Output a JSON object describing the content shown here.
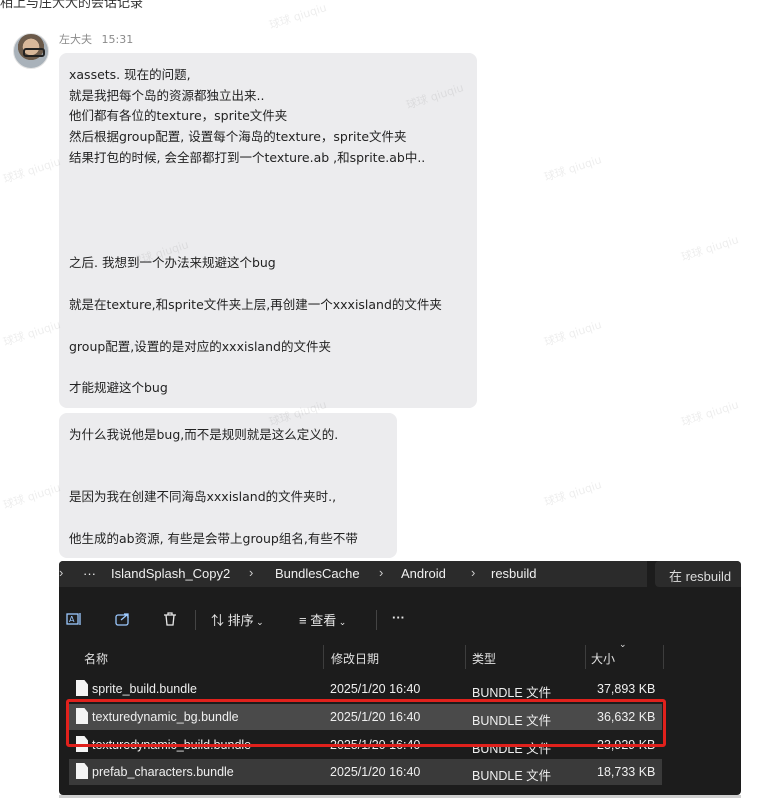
{
  "top_cut_text": "相上与庄大大的会话记录",
  "message": {
    "sender": "左大夫",
    "time": "15:31",
    "bubble1_lines": [
      "xassets. 现在的问题,",
      "就是我把每个岛的资源都独立出来..",
      "他们都有各位的texture，sprite文件夹",
      "然后根据group配置, 设置每个海岛的texture，sprite文件夹",
      "结果打包的时候, 会全部都打到一个texture.ab ,和sprite.ab中..",
      "之后. 我想到一个办法来规避这个bug",
      "就是在texture,和sprite文件夹上层,再创建一个xxxisland的文件夹",
      "group配置,设置的是对应的xxxisland的文件夹",
      "才能规避这个bug"
    ],
    "bubble2_lines": [
      "为什么我说他是bug,而不是规则就是这么定义的.",
      "是因为我在创建不同海岛xxxisland的文件夹时.,",
      "他生成的ab资源, 有些是会带上group组名,有些不带"
    ]
  },
  "watermark_text": "球球 qiuqiu",
  "explorer": {
    "breadcrumb": [
      "IslandSplash_Copy2",
      "BundlesCache",
      "Android",
      "resbuild"
    ],
    "more_crumbs": "···",
    "search_placeholder": "在 resbuild",
    "toolbar": {
      "sort_label": "排序",
      "view_label": "查看",
      "more_label": "···"
    },
    "columns": [
      "名称",
      "修改日期",
      "类型",
      "大小"
    ],
    "files": [
      {
        "name": "sprite_build.bundle",
        "date": "2025/1/20 16:40",
        "type": "BUNDLE 文件",
        "size": "37,893 KB"
      },
      {
        "name": "texturedynamic_bg.bundle",
        "date": "2025/1/20 16:40",
        "type": "BUNDLE 文件",
        "size": "36,632 KB"
      },
      {
        "name": "texturedynamic_build.bundle",
        "date": "2025/1/20 16:40",
        "type": "BUNDLE 文件",
        "size": "23,929 KB"
      },
      {
        "name": "prefab_characters.bundle",
        "date": "2025/1/20 16:40",
        "type": "BUNDLE 文件",
        "size": "18,733 KB"
      }
    ],
    "accent_color": "#e0211c"
  }
}
